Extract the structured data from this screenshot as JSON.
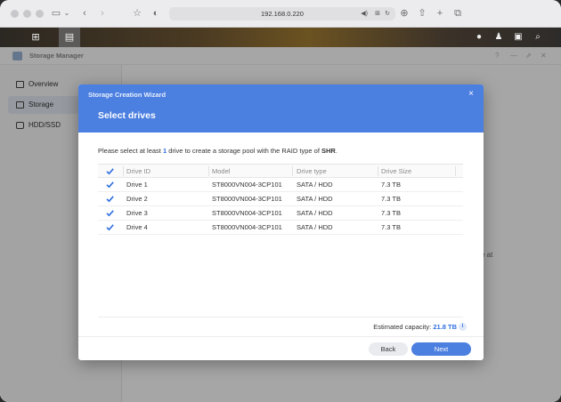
{
  "browser": {
    "url": "192.168.0.220",
    "icons": [
      "sidebar-icon",
      "chevron-down-icon",
      "back-icon",
      "forward-icon",
      "star-icon",
      "shield-icon",
      "audio-icon",
      "translate-icon",
      "reload-icon",
      "download-icon",
      "share-icon",
      "new-tab-icon",
      "tabs-icon"
    ]
  },
  "dsm": {
    "icons": [
      "apps-grid-icon",
      "storage-manager-icon",
      "chat-icon",
      "user-icon",
      "widgets-icon",
      "search-icon"
    ]
  },
  "app": {
    "title": "Storage Manager",
    "sidebar": [
      {
        "label": "Overview",
        "icon": "overview-icon"
      },
      {
        "label": "Storage",
        "icon": "storage-icon"
      },
      {
        "label": "HDD/SSD",
        "icon": "disk-icon"
      }
    ],
    "background_fragment": "e at"
  },
  "wizard": {
    "title": "Storage Creation Wizard",
    "heading": "Select drives",
    "close": "×",
    "instruction_pre": "Please select at least ",
    "instruction_num": "1",
    "instruction_mid": " drive to create a storage pool with the RAID type of ",
    "instruction_raid": "SHR",
    "instruction_post": ".",
    "columns": [
      "Drive ID",
      "Model",
      "Drive type",
      "Drive Size"
    ],
    "rows": [
      {
        "checked": true,
        "id": "Drive 1",
        "model": "ST8000VN004-3CP101",
        "type": "SATA / HDD",
        "size": "7.3 TB"
      },
      {
        "checked": true,
        "id": "Drive 2",
        "model": "ST8000VN004-3CP101",
        "type": "SATA / HDD",
        "size": "7.3 TB"
      },
      {
        "checked": true,
        "id": "Drive 3",
        "model": "ST8000VN004-3CP101",
        "type": "SATA / HDD",
        "size": "7.3 TB"
      },
      {
        "checked": true,
        "id": "Drive 4",
        "model": "ST8000VN004-3CP101",
        "type": "SATA / HDD",
        "size": "7.3 TB"
      }
    ],
    "capacity_label": "Estimated capacity: ",
    "capacity_value": "21.8 TB",
    "back_label": "Back",
    "next_label": "Next"
  },
  "colors": {
    "accent": "#4b7fe0",
    "link": "#2f6fe0"
  }
}
